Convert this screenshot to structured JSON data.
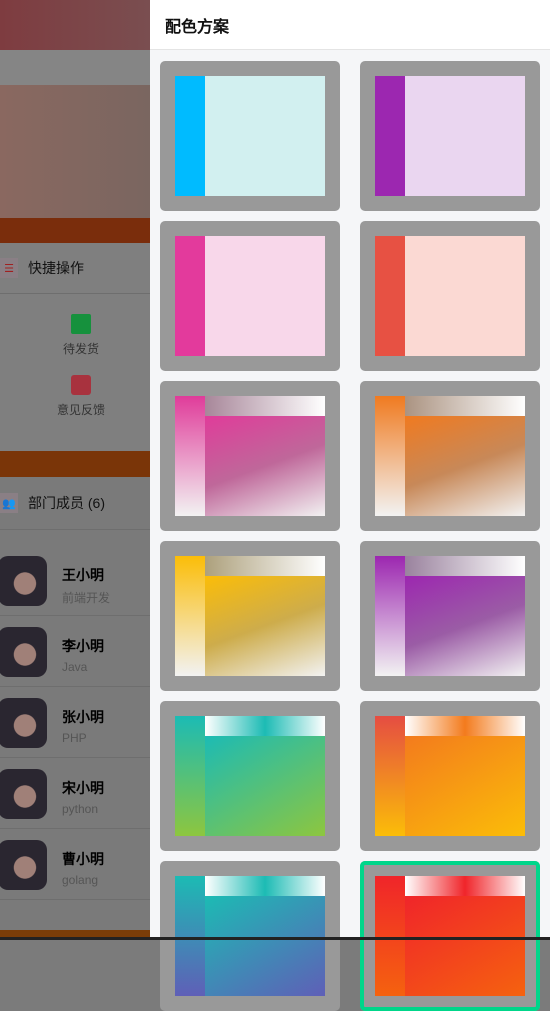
{
  "drawer": {
    "title": "配色方案"
  },
  "quick_actions": {
    "title": "快捷操作",
    "items": [
      {
        "label": "待发货",
        "icon": "package-icon",
        "color": "#16913d"
      },
      {
        "label": "意见反馈",
        "icon": "feedback-icon",
        "color": "#a8323e"
      }
    ]
  },
  "members": {
    "title": "部门成员 (6)",
    "items": [
      {
        "name": "王小明",
        "role": "前端开发"
      },
      {
        "name": "李小明",
        "role": "Java"
      },
      {
        "name": "张小明",
        "role": "PHP"
      },
      {
        "name": "宋小明",
        "role": "python"
      },
      {
        "name": "曹小明",
        "role": "golang"
      }
    ]
  },
  "schemes": [
    {
      "type": "solid",
      "side": "#00bbff",
      "main": "#d2f0f0"
    },
    {
      "type": "solid",
      "side": "#9c27b0",
      "main": "#ead6f0"
    },
    {
      "type": "solid",
      "side": "#e33a9c",
      "main": "#f8d7ea"
    },
    {
      "type": "solid",
      "side": "#e75143",
      "main": "#fbd9d3"
    },
    {
      "type": "fade",
      "color": "#e03c9a"
    },
    {
      "type": "fade",
      "color": "#f07a20"
    },
    {
      "type": "fade",
      "color": "#fbbd08"
    },
    {
      "type": "fade",
      "color": "#9c27b0"
    },
    {
      "type": "grad",
      "from": "#1cbbb4",
      "to": "#8dc63f",
      "accent": "#1cbbb4"
    },
    {
      "type": "grad",
      "from": "#e54d42",
      "to": "#fbbd08",
      "main_from": "#f37b1d",
      "accent": "#f37b1d"
    },
    {
      "type": "grad",
      "from": "#1cbbb4",
      "to": "#5f5fb7",
      "accent": "#1cbbb4"
    },
    {
      "type": "grad",
      "from": "#f0252a",
      "to": "#f5620f",
      "accent": "#f0252a",
      "selected": true
    }
  ],
  "selected_color": "#00d68a"
}
